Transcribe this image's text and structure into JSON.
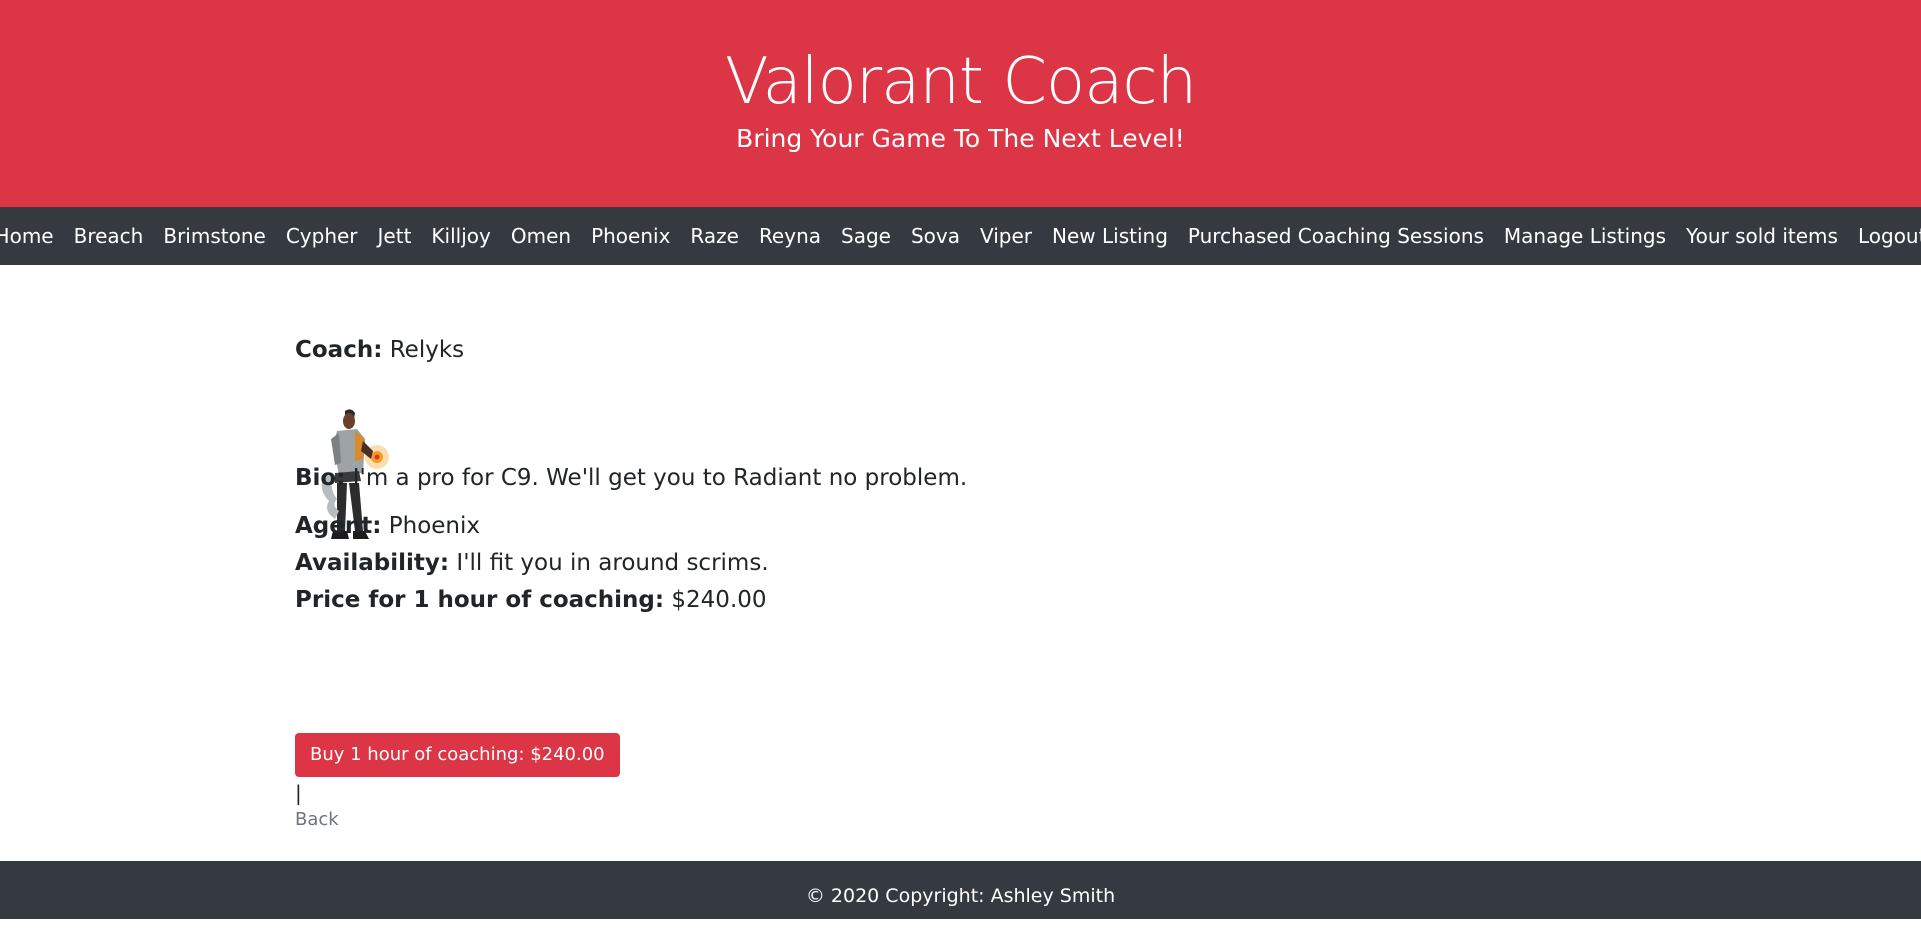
{
  "header": {
    "title": "Valorant Coach",
    "tagline": "Bring Your Game To The Next Level!"
  },
  "nav": {
    "items": [
      {
        "label": "Home"
      },
      {
        "label": "Breach"
      },
      {
        "label": "Brimstone"
      },
      {
        "label": "Cypher"
      },
      {
        "label": "Jett"
      },
      {
        "label": "Killjoy"
      },
      {
        "label": "Omen"
      },
      {
        "label": "Phoenix"
      },
      {
        "label": "Raze"
      },
      {
        "label": "Reyna"
      },
      {
        "label": "Sage"
      },
      {
        "label": "Sova"
      },
      {
        "label": "Viper"
      },
      {
        "label": "New Listing"
      },
      {
        "label": "Purchased Coaching Sessions"
      },
      {
        "label": "Manage Listings"
      },
      {
        "label": "Your sold items"
      },
      {
        "label": "Logout"
      }
    ]
  },
  "listing": {
    "coach_label": "Coach:",
    "coach_name": "Relyks",
    "bio_label": "Bio:",
    "bio": "I'm a pro for C9. We'll get you to Radiant no problem.",
    "agent_label": "Agent:",
    "agent": "Phoenix",
    "availability_label": "Availability:",
    "availability": "I'll fit you in around scrims.",
    "price_label": "Price for 1 hour of coaching:",
    "price": "$240.00",
    "buy_label": "Buy 1 hour of coaching: $240.00",
    "separator": "|",
    "back_label": "Back"
  },
  "footer": {
    "text": "© 2020 Copyright: Ashley Smith"
  },
  "colors": {
    "brand_red": "#dc3545",
    "dark_bar": "#343a40",
    "muted_link": "#6c757d"
  }
}
